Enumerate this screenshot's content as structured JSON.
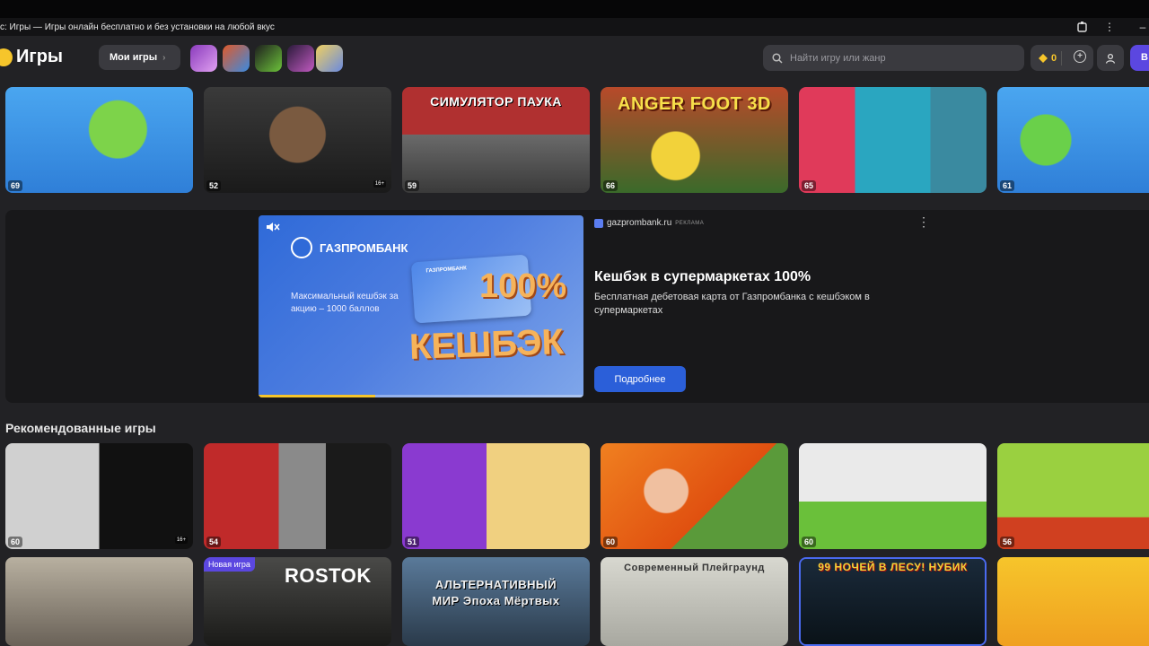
{
  "window": {
    "title": "с: Игры — Игры онлайн бесплатно и без установки на любой вкус"
  },
  "header": {
    "logo": "Игры",
    "my_games": "Мои игры",
    "search_placeholder": "Найти игру или жанр",
    "coins": "0",
    "login": "В"
  },
  "top_row": [
    {
      "rating": "69"
    },
    {
      "rating": "52",
      "age": "16+"
    },
    {
      "rating": "59",
      "caption": "СИМУЛЯТОР ПАУКА"
    },
    {
      "rating": "66",
      "caption": "ANGER FOOT 3D"
    },
    {
      "rating": "65"
    },
    {
      "rating": "61"
    }
  ],
  "ad": {
    "brand": "ГАЗПРОМБАНК",
    "image_text": "Максимальный кешбэк за акцию – 1000 баллов",
    "card_label": "ГАЗПРОМБАНК",
    "big_percent": "100%",
    "big_word": "КЕШБЭК",
    "source": "gazprombank.ru",
    "source_tag": "РЕКЛАМА",
    "title": "Кешбэк в супермаркетах 100%",
    "description": "Бесплатная дебетовая карта от Газпромбанка с кешбэком в супермаркетах",
    "button": "Подробнее",
    "video_progress": 0.36
  },
  "recommended": {
    "title": "Рекомендованные игры",
    "row1": [
      {
        "rating": "60",
        "age": "16+"
      },
      {
        "rating": "54"
      },
      {
        "rating": "51"
      },
      {
        "rating": "60"
      },
      {
        "rating": "60"
      },
      {
        "rating": "56"
      }
    ],
    "row2": [
      {},
      {
        "badge": "Новая игра",
        "caption": "ROSTOK"
      },
      {
        "caption": "АЛЬТЕРНАТИВНЫЙ МИР Эпоха Мёртвых"
      },
      {
        "caption": "Современный Плейграунд"
      },
      {
        "caption": "99 НОЧЕЙ В ЛЕСУ! НУБИК"
      },
      {}
    ]
  },
  "icons": {
    "extension": "puzzle-icon",
    "menu": "kebab-icon",
    "search": "search-icon",
    "coin": "coin-icon",
    "add": "plus-circle-icon",
    "profile": "user-icon",
    "mute": "muted-speaker-icon"
  }
}
